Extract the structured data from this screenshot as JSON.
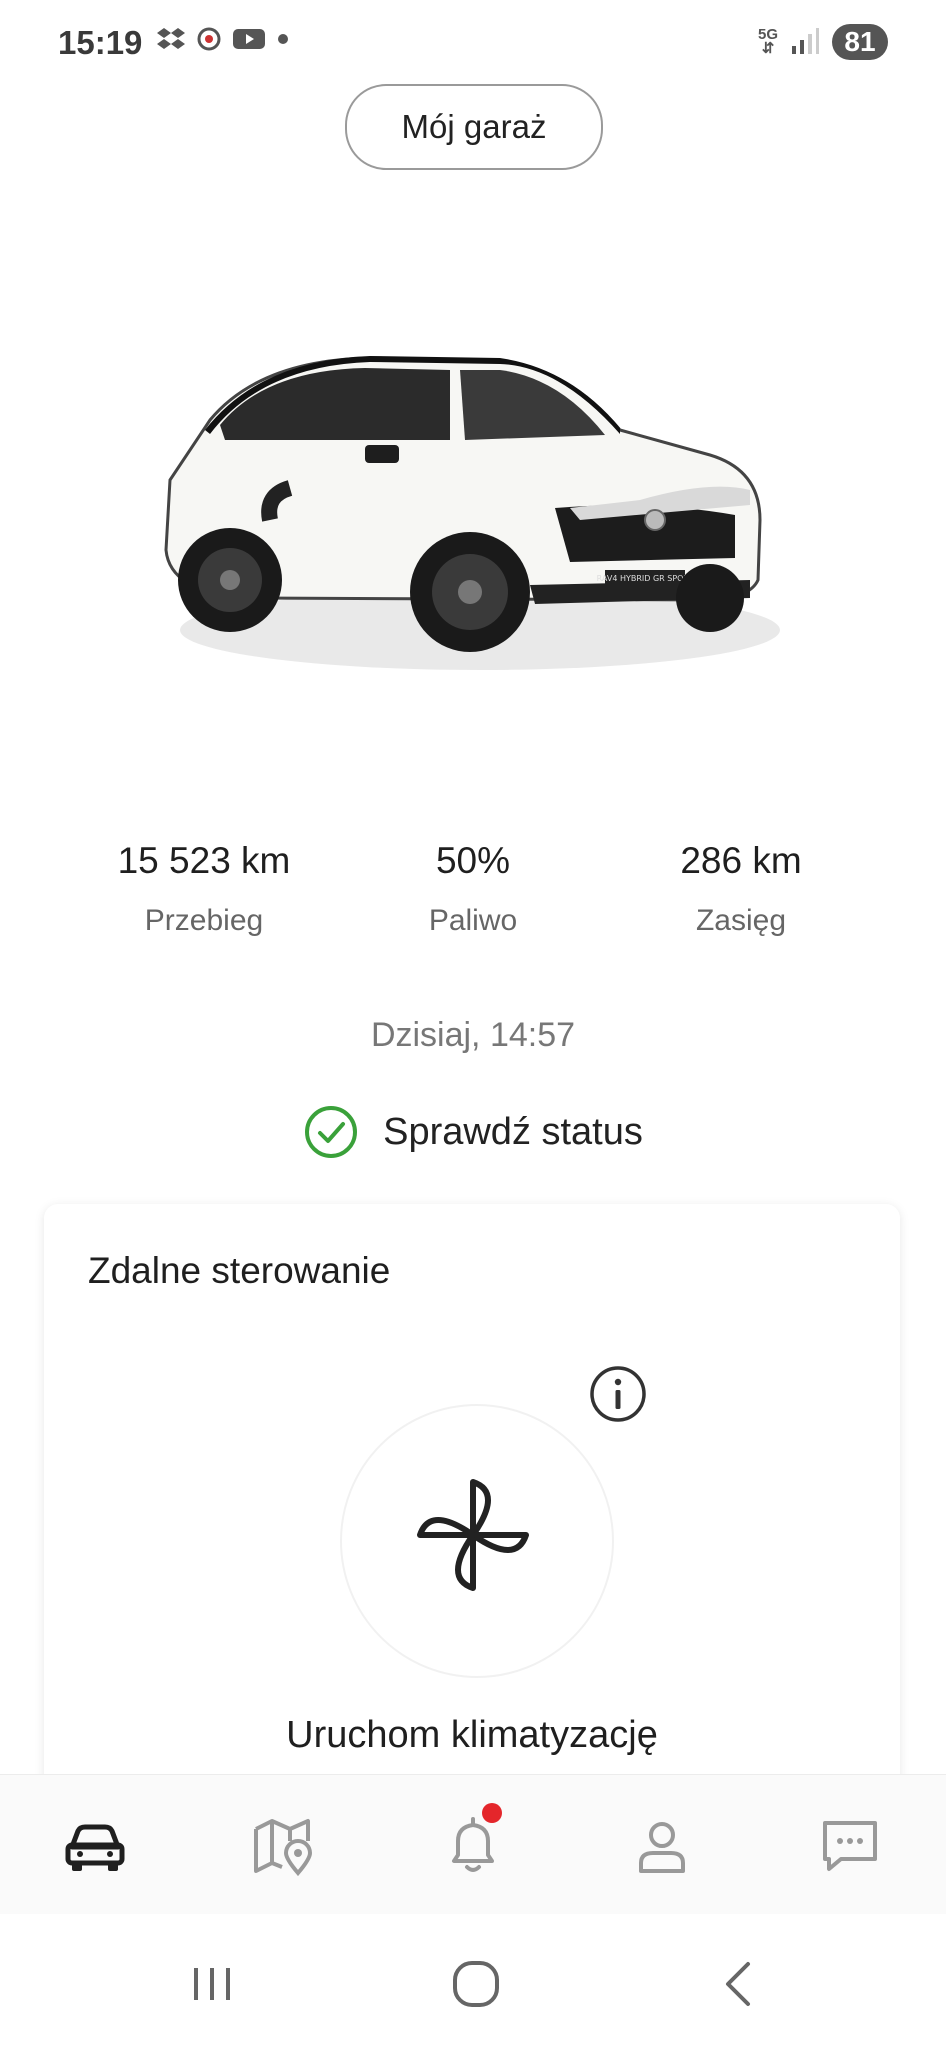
{
  "status_bar": {
    "time": "15:19",
    "network": "5G",
    "battery": "81",
    "icons": [
      "dropbox-icon",
      "app-notification-icon",
      "youtube-icon",
      "dot-icon",
      "signal-icon"
    ]
  },
  "header": {
    "garage_button": "Mój garaż"
  },
  "car": {
    "image": "toyota-rav4-white-car-image"
  },
  "stats": [
    {
      "value": "15 523 km",
      "label": "Przebieg"
    },
    {
      "value": "50%",
      "label": "Paliwo"
    },
    {
      "value": "286 km",
      "label": "Zasięg"
    }
  ],
  "last_update": "Dzisiaj, 14:57",
  "status_link": {
    "label": "Sprawdź status",
    "color": "#3aa13a"
  },
  "remote_card": {
    "title": "Zdalne sterowanie",
    "action_label": "Uruchom klimatyzację"
  },
  "bottom_nav": {
    "items": [
      "car-icon",
      "map-icon",
      "bell-icon",
      "profile-icon",
      "chat-icon"
    ],
    "active": "car-icon",
    "badge_color": "#e4262b"
  },
  "system_nav": [
    "recents-icon",
    "home-icon",
    "back-icon"
  ]
}
